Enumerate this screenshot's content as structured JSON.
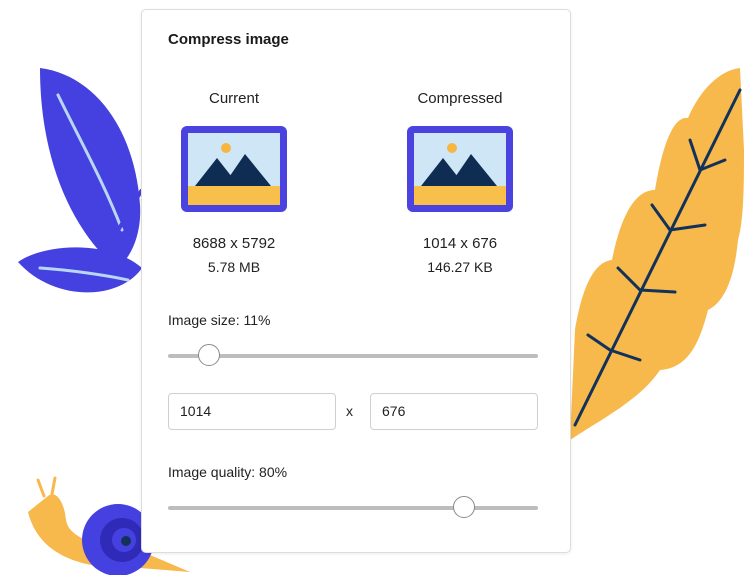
{
  "dialog": {
    "title": "Compress image",
    "current": {
      "label": "Current",
      "dimensions": "8688 x 5792",
      "file_size": "5.78 MB"
    },
    "compressed": {
      "label": "Compressed",
      "dimensions": "1014 x 676",
      "file_size": "146.27 KB"
    },
    "image_size": {
      "label": "Image size: 11%",
      "value_percent": 11
    },
    "width_value": "1014",
    "times_symbol": "x",
    "height_value": "676",
    "image_quality": {
      "label": "Image quality: 80%",
      "value_percent": 80
    }
  },
  "colors": {
    "frame": "#4b43e0",
    "sky": "#cfe6f6",
    "mountain": "#0f2d52",
    "ground": "#f8bf4b",
    "sun": "#f7b640",
    "leaf_blue": "#4540e0",
    "leaf_yellow": "#f7b84c"
  }
}
